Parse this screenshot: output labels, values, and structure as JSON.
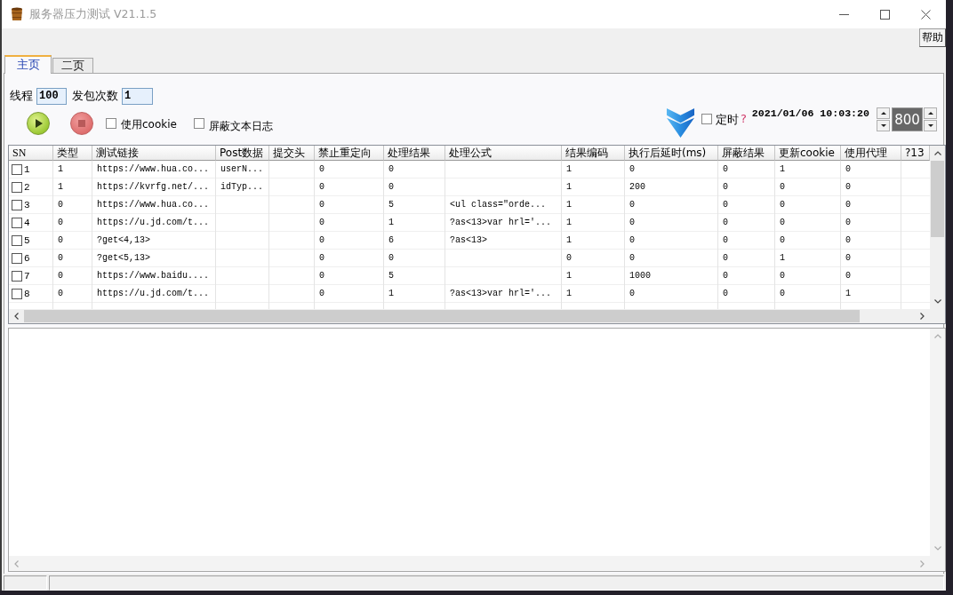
{
  "window": {
    "title": "服务器压力测试 V21.1.5"
  },
  "help_button": {
    "label": "帮助"
  },
  "tabs": [
    {
      "label": "主页",
      "selected": true
    },
    {
      "label": "二页",
      "selected": false
    }
  ],
  "fields": [
    {
      "label": "线程",
      "value": "100"
    },
    {
      "label": "发包次数",
      "value": "1"
    }
  ],
  "options": [
    {
      "label": "使用cookie",
      "checked": false
    },
    {
      "label": "屏蔽文本日志",
      "checked": false
    }
  ],
  "timer": {
    "label": "定时",
    "checked": false,
    "help_mark": "?",
    "datetime": "2021/01/06 10:03:20",
    "interval": "800"
  },
  "table": {
    "columns": [
      "SN",
      "类型",
      "测试链接",
      "Post数据",
      "提交头",
      "禁止重定向",
      "处理结果",
      "处理公式",
      "结果编码",
      "执行后延时(ms)",
      "屏蔽结果",
      "更新cookie",
      "使用代理",
      "?13"
    ],
    "rows": [
      {
        "checked": false,
        "sn": "1",
        "type": "1",
        "url": "https://www.hua.co...",
        "post_data": "userN...",
        "no_redirect": "0",
        "result_mode": "0",
        "result_code": "1",
        "delay_ms": "0",
        "hide_result": "0",
        "update_cookie": "1",
        "use_proxy": "0"
      },
      {
        "checked": false,
        "sn": "2",
        "type": "1",
        "url": "https://kvrfg.net/...",
        "post_data": "idTyp...",
        "no_redirect": "0",
        "result_mode": "0",
        "result_code": "1",
        "delay_ms": "200",
        "hide_result": "0",
        "update_cookie": "0",
        "use_proxy": "0"
      },
      {
        "checked": false,
        "sn": "3",
        "type": "0",
        "url": "https://www.hua.co...",
        "no_redirect": "0",
        "result_mode": "5",
        "formula": "<ul class=\"orde...",
        "result_code": "1",
        "delay_ms": "0",
        "hide_result": "0",
        "update_cookie": "0",
        "use_proxy": "0"
      },
      {
        "checked": false,
        "sn": "4",
        "type": "0",
        "url": "https://u.jd.com/t...",
        "no_redirect": "0",
        "result_mode": "1",
        "formula": "?as<13>var hrl='...",
        "result_code": "1",
        "delay_ms": "0",
        "hide_result": "0",
        "update_cookie": "0",
        "use_proxy": "0"
      },
      {
        "checked": false,
        "sn": "5",
        "type": "0",
        "url": "?get<4,13>",
        "no_redirect": "0",
        "result_mode": "6",
        "formula": "?as<13>",
        "result_code": "1",
        "delay_ms": "0",
        "hide_result": "0",
        "update_cookie": "0",
        "use_proxy": "0"
      },
      {
        "checked": false,
        "sn": "6",
        "type": "0",
        "url": "?get<5,13>",
        "no_redirect": "0",
        "result_mode": "0",
        "result_code": "0",
        "delay_ms": "0",
        "hide_result": "0",
        "update_cookie": "1",
        "use_proxy": "0"
      },
      {
        "checked": false,
        "sn": "7",
        "type": "0",
        "url": "https://www.baidu....",
        "no_redirect": "0",
        "result_mode": "5",
        "result_code": "1",
        "delay_ms": "1000",
        "hide_result": "0",
        "update_cookie": "0",
        "use_proxy": "0"
      },
      {
        "checked": false,
        "sn": "8",
        "type": "0",
        "url": "https://u.jd.com/t...",
        "no_redirect": "0",
        "result_mode": "1",
        "formula": "?as<13>var hrl='...",
        "result_code": "1",
        "delay_ms": "0",
        "hide_result": "0",
        "update_cookie": "0",
        "use_proxy": "1"
      }
    ]
  }
}
